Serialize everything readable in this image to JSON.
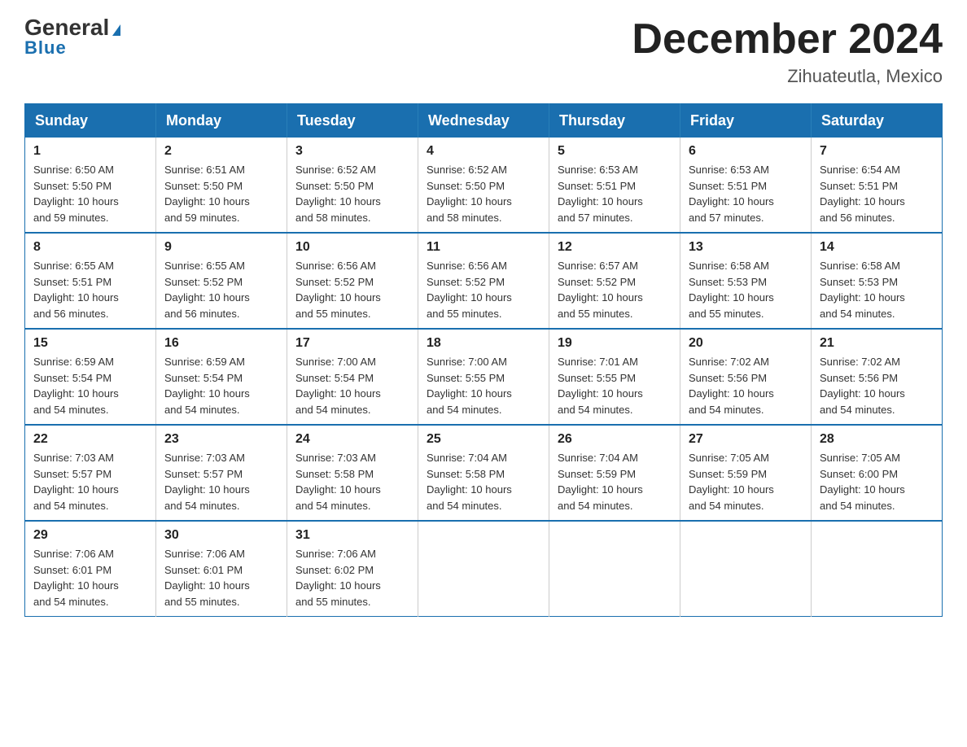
{
  "logo": {
    "name_part1": "General",
    "name_part2": "Blue"
  },
  "title": {
    "month_year": "December 2024",
    "location": "Zihuateutla, Mexico"
  },
  "weekdays": [
    "Sunday",
    "Monday",
    "Tuesday",
    "Wednesday",
    "Thursday",
    "Friday",
    "Saturday"
  ],
  "weeks": [
    [
      {
        "day": "1",
        "sunrise": "6:50 AM",
        "sunset": "5:50 PM",
        "daylight": "10 hours and 59 minutes."
      },
      {
        "day": "2",
        "sunrise": "6:51 AM",
        "sunset": "5:50 PM",
        "daylight": "10 hours and 59 minutes."
      },
      {
        "day": "3",
        "sunrise": "6:52 AM",
        "sunset": "5:50 PM",
        "daylight": "10 hours and 58 minutes."
      },
      {
        "day": "4",
        "sunrise": "6:52 AM",
        "sunset": "5:50 PM",
        "daylight": "10 hours and 58 minutes."
      },
      {
        "day": "5",
        "sunrise": "6:53 AM",
        "sunset": "5:51 PM",
        "daylight": "10 hours and 57 minutes."
      },
      {
        "day": "6",
        "sunrise": "6:53 AM",
        "sunset": "5:51 PM",
        "daylight": "10 hours and 57 minutes."
      },
      {
        "day": "7",
        "sunrise": "6:54 AM",
        "sunset": "5:51 PM",
        "daylight": "10 hours and 56 minutes."
      }
    ],
    [
      {
        "day": "8",
        "sunrise": "6:55 AM",
        "sunset": "5:51 PM",
        "daylight": "10 hours and 56 minutes."
      },
      {
        "day": "9",
        "sunrise": "6:55 AM",
        "sunset": "5:52 PM",
        "daylight": "10 hours and 56 minutes."
      },
      {
        "day": "10",
        "sunrise": "6:56 AM",
        "sunset": "5:52 PM",
        "daylight": "10 hours and 55 minutes."
      },
      {
        "day": "11",
        "sunrise": "6:56 AM",
        "sunset": "5:52 PM",
        "daylight": "10 hours and 55 minutes."
      },
      {
        "day": "12",
        "sunrise": "6:57 AM",
        "sunset": "5:52 PM",
        "daylight": "10 hours and 55 minutes."
      },
      {
        "day": "13",
        "sunrise": "6:58 AM",
        "sunset": "5:53 PM",
        "daylight": "10 hours and 55 minutes."
      },
      {
        "day": "14",
        "sunrise": "6:58 AM",
        "sunset": "5:53 PM",
        "daylight": "10 hours and 54 minutes."
      }
    ],
    [
      {
        "day": "15",
        "sunrise": "6:59 AM",
        "sunset": "5:54 PM",
        "daylight": "10 hours and 54 minutes."
      },
      {
        "day": "16",
        "sunrise": "6:59 AM",
        "sunset": "5:54 PM",
        "daylight": "10 hours and 54 minutes."
      },
      {
        "day": "17",
        "sunrise": "7:00 AM",
        "sunset": "5:54 PM",
        "daylight": "10 hours and 54 minutes."
      },
      {
        "day": "18",
        "sunrise": "7:00 AM",
        "sunset": "5:55 PM",
        "daylight": "10 hours and 54 minutes."
      },
      {
        "day": "19",
        "sunrise": "7:01 AM",
        "sunset": "5:55 PM",
        "daylight": "10 hours and 54 minutes."
      },
      {
        "day": "20",
        "sunrise": "7:02 AM",
        "sunset": "5:56 PM",
        "daylight": "10 hours and 54 minutes."
      },
      {
        "day": "21",
        "sunrise": "7:02 AM",
        "sunset": "5:56 PM",
        "daylight": "10 hours and 54 minutes."
      }
    ],
    [
      {
        "day": "22",
        "sunrise": "7:03 AM",
        "sunset": "5:57 PM",
        "daylight": "10 hours and 54 minutes."
      },
      {
        "day": "23",
        "sunrise": "7:03 AM",
        "sunset": "5:57 PM",
        "daylight": "10 hours and 54 minutes."
      },
      {
        "day": "24",
        "sunrise": "7:03 AM",
        "sunset": "5:58 PM",
        "daylight": "10 hours and 54 minutes."
      },
      {
        "day": "25",
        "sunrise": "7:04 AM",
        "sunset": "5:58 PM",
        "daylight": "10 hours and 54 minutes."
      },
      {
        "day": "26",
        "sunrise": "7:04 AM",
        "sunset": "5:59 PM",
        "daylight": "10 hours and 54 minutes."
      },
      {
        "day": "27",
        "sunrise": "7:05 AM",
        "sunset": "5:59 PM",
        "daylight": "10 hours and 54 minutes."
      },
      {
        "day": "28",
        "sunrise": "7:05 AM",
        "sunset": "6:00 PM",
        "daylight": "10 hours and 54 minutes."
      }
    ],
    [
      {
        "day": "29",
        "sunrise": "7:06 AM",
        "sunset": "6:01 PM",
        "daylight": "10 hours and 54 minutes."
      },
      {
        "day": "30",
        "sunrise": "7:06 AM",
        "sunset": "6:01 PM",
        "daylight": "10 hours and 55 minutes."
      },
      {
        "day": "31",
        "sunrise": "7:06 AM",
        "sunset": "6:02 PM",
        "daylight": "10 hours and 55 minutes."
      },
      null,
      null,
      null,
      null
    ]
  ]
}
